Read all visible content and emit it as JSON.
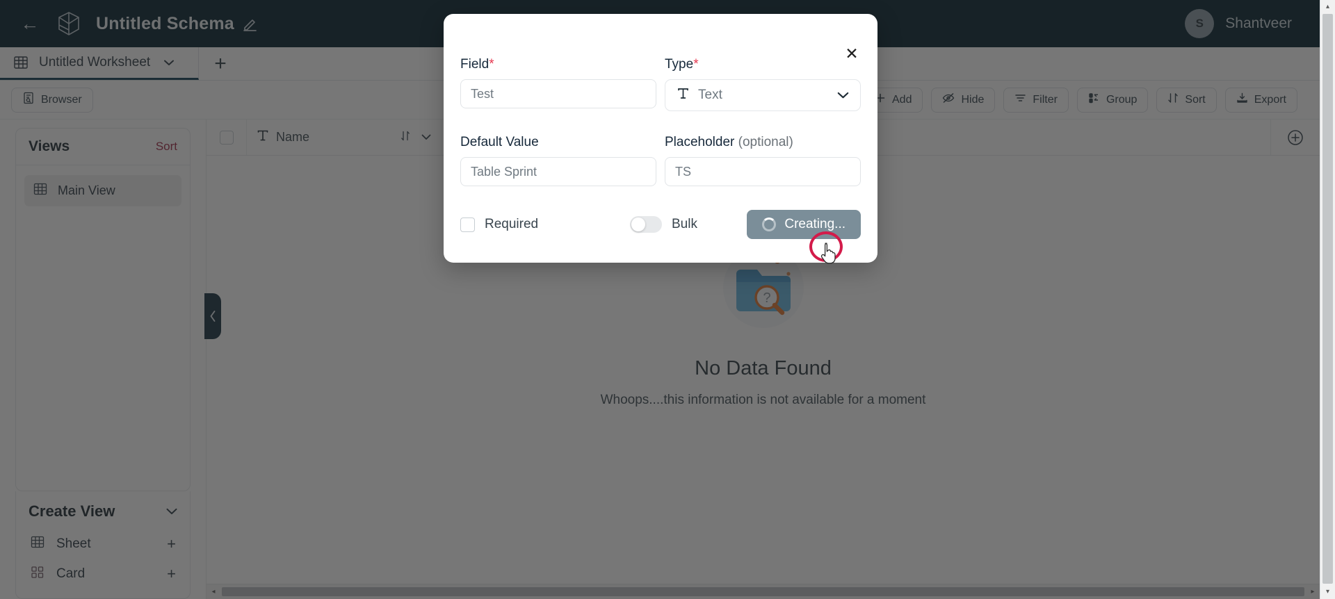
{
  "header": {
    "back_icon": "arrow-left-icon",
    "logo_icon": "cube-logo-icon",
    "schema_title": "Untitled Schema",
    "edit_icon": "pencil-icon",
    "user": {
      "initial": "S",
      "name": "Shantveer"
    }
  },
  "tabs": {
    "worksheet": {
      "icon": "table-grid-icon",
      "label": "Untitled Worksheet",
      "caret": "⌄"
    },
    "add_tab_label": "+"
  },
  "toolbar": {
    "browser": {
      "icon": "browser-icon",
      "label": "Browser"
    },
    "actions": [
      {
        "icon": "plus-icon",
        "label": "Add"
      },
      {
        "icon": "eye-off-icon",
        "label": "Hide"
      },
      {
        "icon": "filter-icon",
        "label": "Filter"
      },
      {
        "icon": "group-icon",
        "label": "Group"
      },
      {
        "icon": "sort-icon",
        "label": "Sort"
      },
      {
        "icon": "export-icon",
        "label": "Export"
      }
    ]
  },
  "sidebar": {
    "views_title": "Views",
    "sort_label": "Sort",
    "views": [
      {
        "icon": "grid-icon",
        "label": "Main View"
      }
    ],
    "create_view": {
      "title": "Create View",
      "caret": "⌄",
      "items": [
        {
          "icon": "sheet-icon",
          "label": "Sheet",
          "add": "+"
        },
        {
          "icon": "card-icon",
          "label": "Card",
          "add": "+"
        }
      ]
    },
    "collapse_icon": "chevron-left-icon"
  },
  "grid": {
    "columns": [
      {
        "type_icon": "text-type-icon",
        "label": "Name",
        "sort_icon": "sort-updown-icon",
        "menu_icon": "chevron-down-icon"
      }
    ],
    "add_column_icon": "plus-circle-icon",
    "empty_state": {
      "illustration": "folder-search-icon",
      "title": "No Data Found",
      "subtitle": "Whoops....this information is not available for a moment"
    }
  },
  "modal": {
    "close_icon": "close-icon",
    "field": {
      "label": "Field",
      "required_mark": "*",
      "value": "Test",
      "placeholder": "Test"
    },
    "type": {
      "label": "Type",
      "required_mark": "*",
      "icon": "text-type-icon",
      "value": "Text",
      "caret": "⌄"
    },
    "default_value": {
      "label": "Default Value",
      "value": "Table Sprint",
      "placeholder": "Table Sprint"
    },
    "placeholder_field": {
      "label": "Placeholder",
      "optional": "(optional)",
      "value": "TS",
      "placeholder": "TS"
    },
    "required_checkbox": {
      "label": "Required",
      "checked": false
    },
    "bulk_toggle": {
      "label": "Bulk",
      "on": false
    },
    "submit": {
      "label": "Creating...",
      "spinner": true,
      "disabled": true
    }
  },
  "scrollbars": {
    "h_left_arrow": "◂",
    "h_right_arrow": "▸",
    "v_up_arrow": "▴",
    "v_down_arrow": "▾"
  },
  "colors": {
    "header_bg": "#04202e",
    "accent_red": "#9e2945",
    "required_star": "#e63950",
    "button_disabled": "#7b8e99",
    "click_ring": "#d31b4a"
  }
}
